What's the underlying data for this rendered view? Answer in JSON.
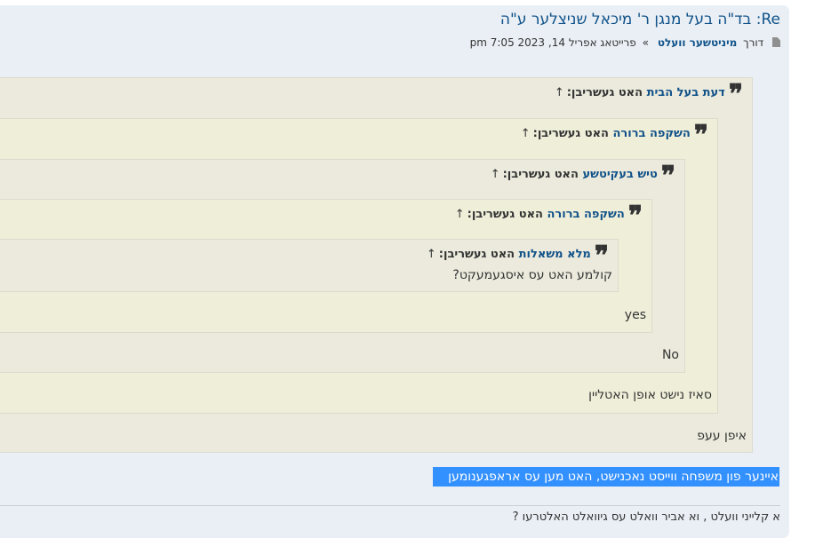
{
  "post": {
    "title": "Re: בד\"ה בעל מנגן ר' מיכאל שניצלער ע\"ה",
    "by": "דורך",
    "author": "מיניטשער וועלט",
    "separator": "»",
    "date": "פרייטאג אפריל 14, 2023 7:05 pm",
    "icon": "file-icon"
  },
  "quotes": [
    {
      "user": "דעת בעל הבית",
      "wrote": " האט געשריבן:",
      "arrow": "↑",
      "after": "איפן עעפ"
    },
    {
      "user": "השקפה ברורה",
      "wrote": " האט געשריבן:",
      "arrow": "↑",
      "after": "סאיז נישט אופן האטליין"
    },
    {
      "user": "טיש בעקיטשע",
      "wrote": " האט געשריבן:",
      "arrow": "↑",
      "after": "No"
    },
    {
      "user": "השקפה ברורה",
      "wrote": " האט געשריבן:",
      "arrow": "↑",
      "after": "yes"
    },
    {
      "user": "מלא משאלות",
      "wrote": " האט געשריבן:",
      "arrow": "↑",
      "text": "קולמע האט עס איסגעמעקט?"
    }
  ],
  "selected_text": "איינער פון משפחה ווייסט נאכנישט, האט מען עס אראפגענומען",
  "next_line": "א קלייני וועלט , וא אביר וואלט עס גיוואלט האלטרעו ?"
}
